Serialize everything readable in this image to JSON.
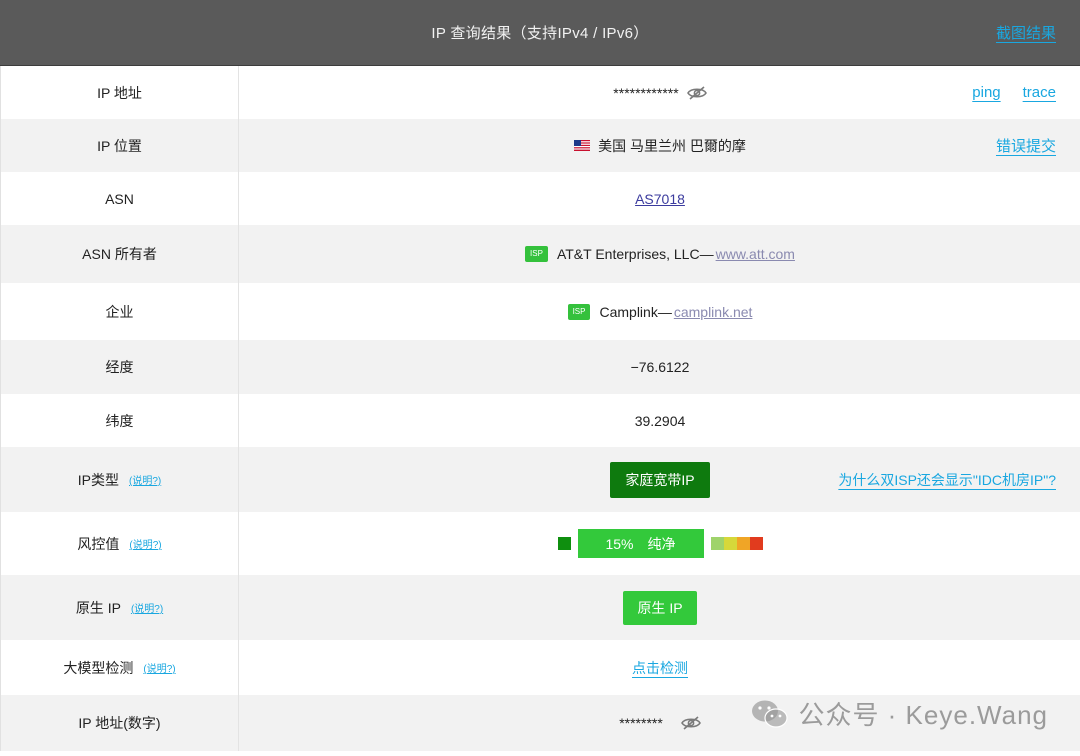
{
  "header": {
    "title": "IP 查询结果（支持IPv4 / IPv6）",
    "screenshot_link": "截图结果"
  },
  "rows": {
    "ip": {
      "label": "IP 地址",
      "value": "************",
      "ping": "ping",
      "trace": "trace",
      "icon": "eye-slash-icon"
    },
    "location": {
      "label": "IP 位置",
      "value": "美国 马里兰州 巴爾的摩",
      "flag": "us-flag-icon",
      "report": "错误提交"
    },
    "asn": {
      "label": "ASN",
      "value": "AS7018"
    },
    "asn_owner": {
      "label": "ASN 所有者",
      "badge": "ISP",
      "name": "AT&T Enterprises, LLC—",
      "domain": "www.att.com"
    },
    "company": {
      "label": "企业",
      "badge": "ISP",
      "name": "Camplink—",
      "domain": "camplink.net"
    },
    "longitude": {
      "label": "经度",
      "value": "−76.6122"
    },
    "latitude": {
      "label": "纬度",
      "value": "39.2904"
    },
    "ip_type": {
      "label": "IP类型",
      "help": "(说明?)",
      "value": "家庭宽带IP",
      "question": "为什么双ISP还会显示\"IDC机房IP\"?"
    },
    "risk": {
      "label": "风控值",
      "help": "(说明?)",
      "percent": "15%",
      "level": "纯净",
      "score": 0.15
    },
    "native": {
      "label": "原生 IP",
      "help": "(说明?)",
      "value": "原生 IP"
    },
    "llm": {
      "label": "大模型检测",
      "help": "(说明?)",
      "value": "点击检测"
    },
    "ip_numeric": {
      "label": "IP 地址(数字)",
      "value": "********",
      "icon": "eye-slash-icon"
    }
  },
  "colors": {
    "header_bg": "#5a5a5a",
    "link": "#19a7e0",
    "green_dark": "#0e7a0e",
    "green_light": "#33c93b",
    "risk_scale": [
      "#9fd36b",
      "#d6d83a",
      "#f0a526",
      "#e13b1e"
    ]
  },
  "watermark": {
    "text": "公众号 · Keye.Wang",
    "icon": "wechat-icon"
  }
}
